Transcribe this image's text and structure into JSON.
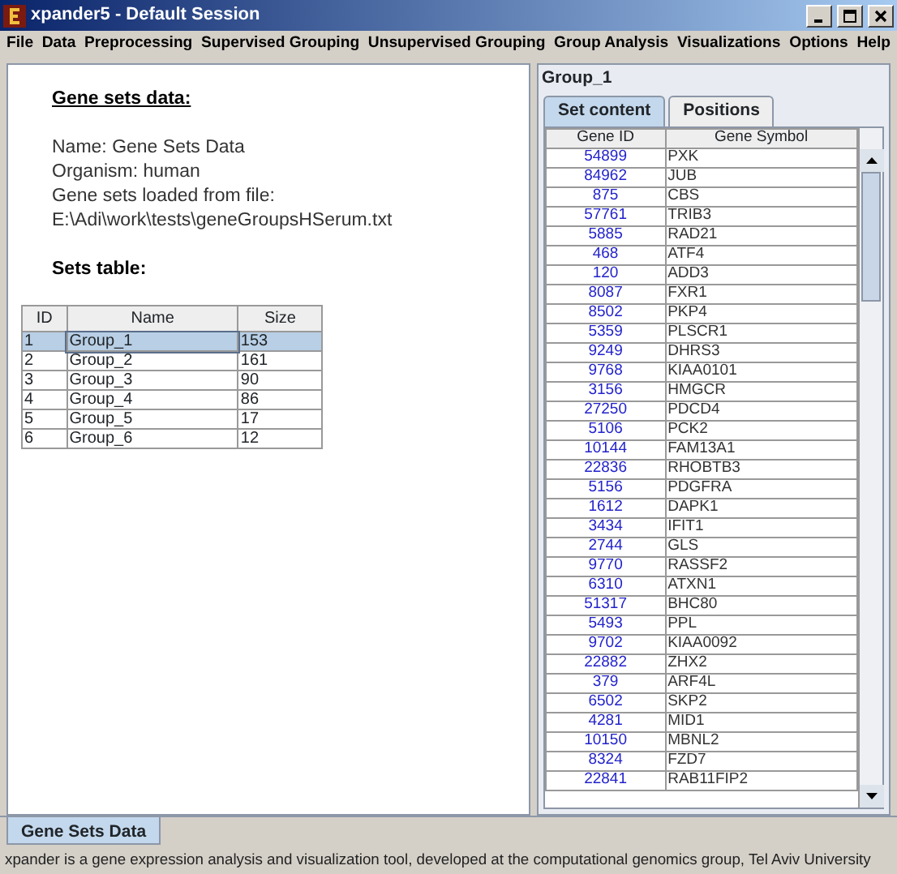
{
  "window": {
    "title": "xpander5 - Default Session"
  },
  "menu": [
    "File",
    "Data",
    "Preprocessing",
    "Supervised Grouping",
    "Unsupervised Grouping",
    "Group Analysis",
    "Visualizations",
    "Options",
    "Help"
  ],
  "info": {
    "heading": "Gene sets data:",
    "lines": [
      "Name: Gene Sets Data",
      "Organism: human",
      "Gene sets loaded from file:",
      "E:\\Adi\\work\\tests\\geneGroupsHSerum.txt"
    ],
    "table_heading": "Sets table:"
  },
  "sets_table": {
    "columns": [
      "ID",
      "Name",
      "Size"
    ],
    "rows": [
      {
        "cells": [
          "1",
          "Group_1",
          "153"
        ],
        "selected": true
      },
      {
        "cells": [
          "2",
          "Group_2",
          "161"
        ],
        "selected": false
      },
      {
        "cells": [
          "3",
          "Group_3",
          "90"
        ],
        "selected": false
      },
      {
        "cells": [
          "4",
          "Group_4",
          "86"
        ],
        "selected": false
      },
      {
        "cells": [
          "5",
          "Group_5",
          "17"
        ],
        "selected": false
      },
      {
        "cells": [
          "6",
          "Group_6",
          "12"
        ],
        "selected": false
      }
    ]
  },
  "group_panel": {
    "title": "Group_1",
    "tabs": [
      {
        "label": "Set content",
        "selected": true
      },
      {
        "label": "Positions",
        "selected": false
      }
    ],
    "columns": [
      "Gene ID",
      "Gene Symbol"
    ],
    "rows": [
      [
        "54899",
        "PXK"
      ],
      [
        "84962",
        "JUB"
      ],
      [
        "875",
        "CBS"
      ],
      [
        "57761",
        "TRIB3"
      ],
      [
        "5885",
        "RAD21"
      ],
      [
        "468",
        "ATF4"
      ],
      [
        "120",
        "ADD3"
      ],
      [
        "8087",
        "FXR1"
      ],
      [
        "8502",
        "PKP4"
      ],
      [
        "5359",
        "PLSCR1"
      ],
      [
        "9249",
        "DHRS3"
      ],
      [
        "9768",
        "KIAA0101"
      ],
      [
        "3156",
        "HMGCR"
      ],
      [
        "27250",
        "PDCD4"
      ],
      [
        "5106",
        "PCK2"
      ],
      [
        "10144",
        "FAM13A1"
      ],
      [
        "22836",
        "RHOBTB3"
      ],
      [
        "5156",
        "PDGFRA"
      ],
      [
        "1612",
        "DAPK1"
      ],
      [
        "3434",
        "IFIT1"
      ],
      [
        "2744",
        "GLS"
      ],
      [
        "9770",
        "RASSF2"
      ],
      [
        "6310",
        "ATXN1"
      ],
      [
        "51317",
        "BHC80"
      ],
      [
        "5493",
        "PPL"
      ],
      [
        "9702",
        "KIAA0092"
      ],
      [
        "22882",
        "ZHX2"
      ],
      [
        "379",
        "ARF4L"
      ],
      [
        "6502",
        "SKP2"
      ],
      [
        "4281",
        "MID1"
      ],
      [
        "10150",
        "MBNL2"
      ],
      [
        "8324",
        "FZD7"
      ],
      [
        "22841",
        "RAB11FIP2"
      ]
    ]
  },
  "bottom_tabs": [
    {
      "label": "Gene Sets Data",
      "selected": true
    }
  ],
  "status_bar": "xpander is a gene expression analysis and visualization tool, developed at the computational genomics group, Tel Aviv University"
}
